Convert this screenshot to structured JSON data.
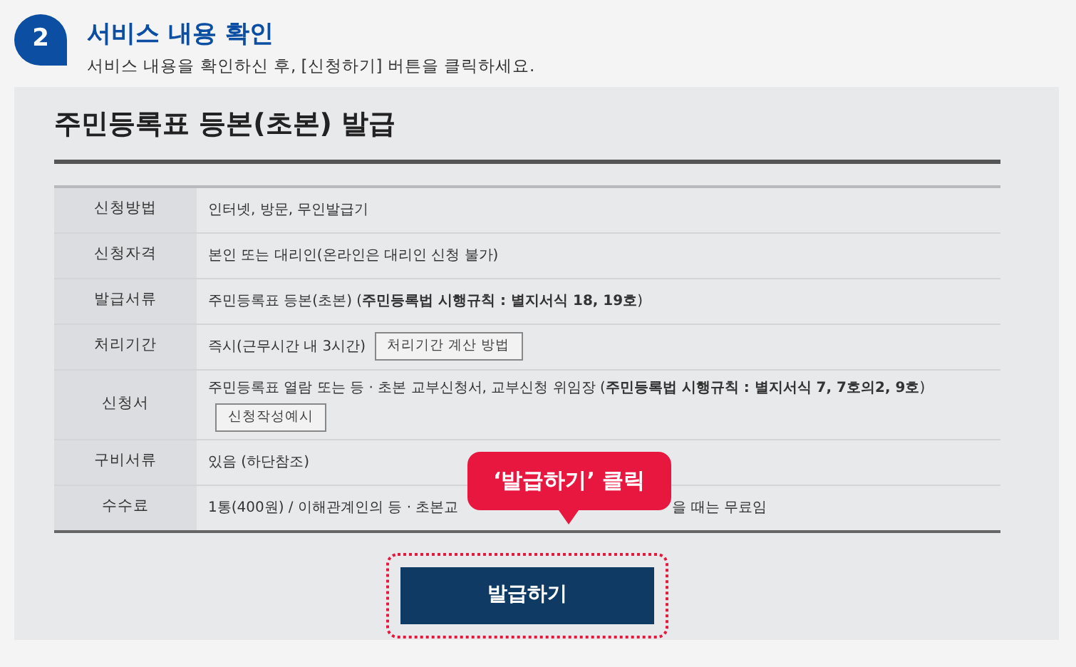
{
  "step": {
    "number": "2",
    "title": "서비스 내용 확인",
    "subtitle": "서비스 내용을 확인하신 후, [신청하기] 버튼을 클릭하세요."
  },
  "service": {
    "title": "주민등록표 등본(초본) 발급",
    "rows": [
      {
        "label": "신청방법",
        "value": "인터넷, 방문, 무인발급기"
      },
      {
        "label": "신청자격",
        "value": "본인 또는 대리인(온라인은 대리인 신청 불가)"
      },
      {
        "label": "발급서류",
        "value": "주민등록표 등본(초본) (**주민등록법 시행규칙 : 별지서식 18, 19호**)"
      },
      {
        "label": "처리기간",
        "value": "즉시(근무시간 내 3시간)",
        "button": "처리기간 계산 방법",
        "button_below": false
      },
      {
        "label": "신청서",
        "value": "주민등록표 열람 또는 등 · 초본 교부신청서, 교부신청 위임장 (**주민등록법 시행규칙 : 별지서식 7, 7호의2, 9호**)",
        "button": "신청작성예시",
        "button_below": true
      },
      {
        "label": "구비서류",
        "value": "있음 (하단참조)"
      },
      {
        "label": "수수료",
        "value_parts": [
          "1통(400원) / 이해관계인의 등 · 초본교",
          "을 때는 무료임"
        ]
      }
    ]
  },
  "callout": "‘발급하기’ 클릭",
  "submit_button": "발급하기"
}
